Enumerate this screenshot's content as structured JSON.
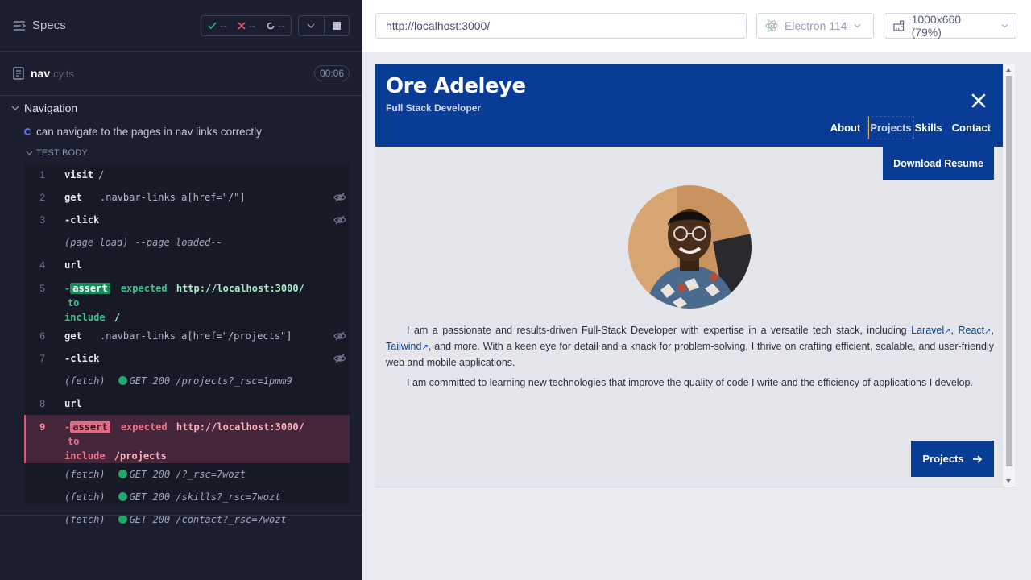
{
  "reporter": {
    "specs_label": "Specs",
    "stats": {
      "passed": "--",
      "failed": "--",
      "pending": "--"
    },
    "file": {
      "name": "nav",
      "ext": "cy.ts",
      "duration": "00:06"
    },
    "suite": {
      "title": "Navigation"
    },
    "test": {
      "title": "can navigate to the pages in nav links correctly"
    },
    "test_body_label": "TEST BODY",
    "commands": [
      {
        "num": "1",
        "name": "visit",
        "message": "/"
      },
      {
        "num": "2",
        "name": "get",
        "message": ".navbar-links a[href=\"/\"]"
      },
      {
        "num": "3",
        "name": "-click",
        "message": ""
      },
      {
        "num": "",
        "name": "(page load)",
        "message": "--page loaded--"
      },
      {
        "num": "4",
        "name": "url",
        "message": ""
      },
      {
        "num": "5",
        "prefix": "-",
        "badge": "assert",
        "kw1": "expected",
        "val1": "http://localhost:3000/",
        "kw2": "to",
        "kw3": "include",
        "val2": "/"
      },
      {
        "num": "6",
        "name": "get",
        "message": ".navbar-links a[href=\"/projects\"]"
      },
      {
        "num": "7",
        "name": "-click",
        "message": ""
      },
      {
        "num": "",
        "name": "(fetch)",
        "message": "GET 200 /projects?_rsc=1pmm9"
      },
      {
        "num": "8",
        "name": "url",
        "message": ""
      },
      {
        "num": "9",
        "prefix": "-",
        "badge": "assert",
        "kw1": "expected",
        "val1": "http://localhost:3000/",
        "kw2": "to",
        "kw3": "include",
        "val2": "/projects"
      },
      {
        "num": "",
        "name": "(fetch)",
        "message": "GET 200 /?_rsc=7wozt"
      },
      {
        "num": "",
        "name": "(fetch)",
        "message": "GET 200 /skills?_rsc=7wozt"
      },
      {
        "num": "",
        "name": "(fetch)",
        "message": "GET 200 /contact?_rsc=7wozt"
      }
    ]
  },
  "runner": {
    "url": "http://localhost:3000/",
    "browser": "Electron 114",
    "viewport": "1000x660",
    "viewport_display": "1000x660",
    "zoom": "(79%)"
  },
  "site": {
    "brand": "Ore Adeleye",
    "tagline": "Full Stack Developer",
    "nav": [
      "About",
      "Projects",
      "Skills",
      "Contact"
    ],
    "resume_button": "Download Resume",
    "bio": {
      "p1_start": "I am a passionate and results-driven Full-Stack Developer with expertise in a versatile tech stack, including",
      "link1": "Laravel",
      "link2": "React",
      "link3": "Tailwind",
      "p1_end": ", and more. With a keen eye for detail and a knack for problem-solving, I thrive on crafting efficient, scalable, and user-friendly web and mobile applications.",
      "p2": "I am committed to learning new technologies that improve the quality of code I write and the efficiency of applications I develop."
    },
    "next_button": "Projects"
  },
  "colors": {
    "nav_bg": "#083c96",
    "reporter_bg": "#1b1e2e",
    "pass": "#1faa69",
    "fail": "#e45770"
  }
}
